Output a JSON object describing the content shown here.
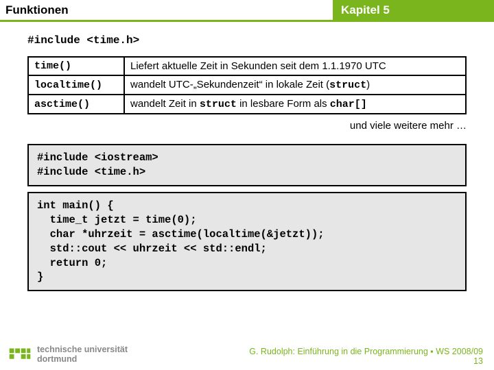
{
  "header": {
    "left": "Funktionen",
    "right": "Kapitel 5"
  },
  "include1": "#include <time.h>",
  "table": {
    "r0": {
      "fn": "time()",
      "desc_a": "Liefert aktuelle Zeit in Sekunden seit dem 1.1.1970 UTC"
    },
    "r1": {
      "fn": "localtime()",
      "desc_a": "wandelt UTC-„Sekundenzeit“ in lokale Zeit (",
      "desc_b": "struct",
      "desc_c": ")"
    },
    "r2": {
      "fn": "asctime()",
      "desc_a": "wandelt Zeit in ",
      "desc_b": "struct",
      "desc_c": " in lesbare Form als ",
      "desc_d": "char[]"
    }
  },
  "more": "und viele weitere mehr …",
  "code1": "#include <iostream>\n#include <time.h>",
  "code2": "int main() {\n  time_t jetzt = time(0);\n  char *uhrzeit = asctime(localtime(&jetzt));\n  std::cout << uhrzeit << std::endl;\n  return 0;\n}",
  "footer": {
    "uni1": "technische universität",
    "uni2": "dortmund",
    "credit": "G. Rudolph: Einführung in die Programmierung ▪ WS 2008/09",
    "page": "13"
  }
}
